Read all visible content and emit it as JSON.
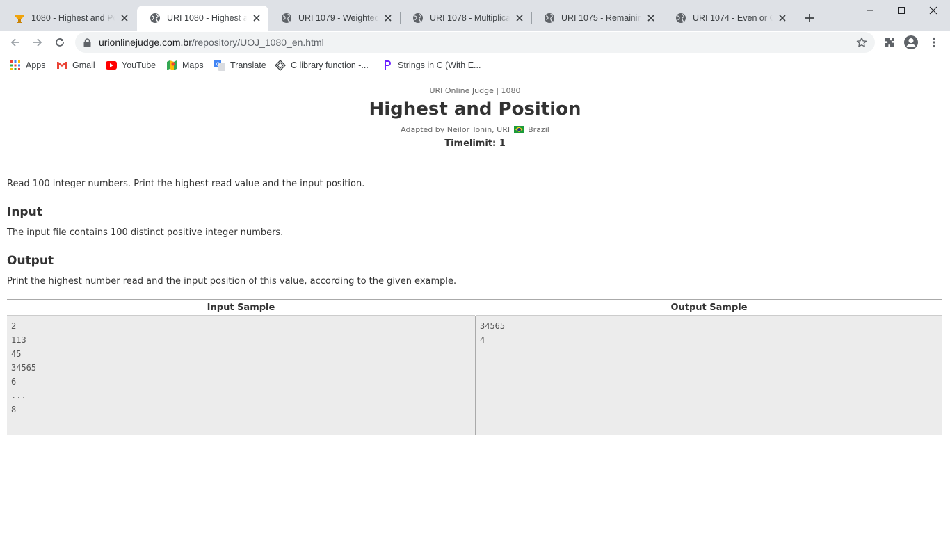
{
  "browser": {
    "tabs": [
      {
        "title": "1080 - Highest and Pos",
        "icon": "uri-trophy-icon",
        "active": false
      },
      {
        "title": "URI 1080 - Highest and",
        "icon": "globe-icon",
        "active": true
      },
      {
        "title": "URI 1079 - Weighted A",
        "icon": "globe-icon",
        "active": false
      },
      {
        "title": "URI 1078 - Multiplicatio",
        "icon": "globe-icon",
        "active": false
      },
      {
        "title": "URI 1075 - Remaining 2",
        "icon": "globe-icon",
        "active": false
      },
      {
        "title": "URI 1074 - Even or Odd",
        "icon": "globe-icon",
        "active": false
      }
    ],
    "url": {
      "host": "urionlinejudge.com.br",
      "path": "/repository/UOJ_1080_en.html"
    },
    "bookmarks": [
      {
        "label": "Apps",
        "icon": "apps-grid-icon"
      },
      {
        "label": "Gmail",
        "icon": "gmail-icon"
      },
      {
        "label": "YouTube",
        "icon": "youtube-icon"
      },
      {
        "label": "Maps",
        "icon": "maps-icon"
      },
      {
        "label": "Translate",
        "icon": "translate-icon"
      },
      {
        "label": "C library function -...",
        "icon": "c-library-icon"
      },
      {
        "label": "Strings in C (With E...",
        "icon": "programiz-icon"
      }
    ]
  },
  "problem": {
    "judge_line": "URI Online Judge | 1080",
    "title": "Highest and Position",
    "adapted_prefix": "Adapted by Neilor Tonin, URI",
    "adapted_country": "Brazil",
    "timelimit": "Timelimit: 1",
    "description": "Read 100 integer numbers. Print the highest read value and the input position.",
    "input_heading": "Input",
    "input_text": "The input file contains 100 distinct positive integer numbers.",
    "output_heading": "Output",
    "output_text": "Print the highest number read and the input position of this value, according to the given example.",
    "samples": {
      "input_header": "Input Sample",
      "output_header": "Output Sample",
      "input_lines": [
        "2",
        "113",
        "45",
        "34565",
        "6",
        "...",
        "8"
      ],
      "output_lines": [
        "34565",
        "4"
      ]
    }
  }
}
